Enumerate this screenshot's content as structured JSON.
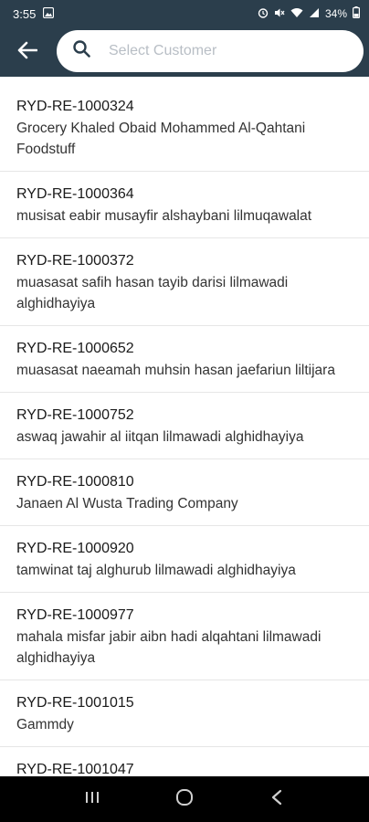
{
  "status_bar": {
    "time": "3:55",
    "battery": "34%",
    "icons": [
      "image-icon",
      "alarm-icon",
      "mute-icon",
      "wifi-icon",
      "signal-icon",
      "battery-icon"
    ]
  },
  "header": {
    "back_icon": "arrow-left-icon",
    "search_placeholder": "Select Customer",
    "search_icon": "search-icon",
    "bg_color": "#2b3e4c"
  },
  "customers": [
    {
      "code": "RYD-RE-1000324",
      "name": "Grocery Khaled Obaid Mohammed Al-Qahtani Foodstuff"
    },
    {
      "code": "RYD-RE-1000364",
      "name": "musisat eabir musayfir alshaybani lilmuqawalat"
    },
    {
      "code": "RYD-RE-1000372",
      "name": "muasasat safih hasan tayib darisi lilmawadi alghidhayiya"
    },
    {
      "code": "RYD-RE-1000652",
      "name": "muasasat naeamah muhsin hasan jaefariun liltijara"
    },
    {
      "code": "RYD-RE-1000752",
      "name": "aswaq jawahir al iitqan lilmawadi alghidhayiya"
    },
    {
      "code": "RYD-RE-1000810",
      "name": "Janaen Al Wusta Trading Company"
    },
    {
      "code": "RYD-RE-1000920",
      "name": "tamwinat taj alghurub lilmawadi alghidhayiya"
    },
    {
      "code": "RYD-RE-1000977",
      "name": "mahala misfar jabir aibn hadi alqahtani lilmawadi alghidhayiya"
    },
    {
      "code": "RYD-RE-1001015",
      "name": "Gammdy"
    },
    {
      "code": "RYD-RE-1001047",
      "name": ""
    }
  ],
  "nav_bar": {
    "icons": [
      "recent-apps-icon",
      "home-icon",
      "back-icon"
    ]
  }
}
